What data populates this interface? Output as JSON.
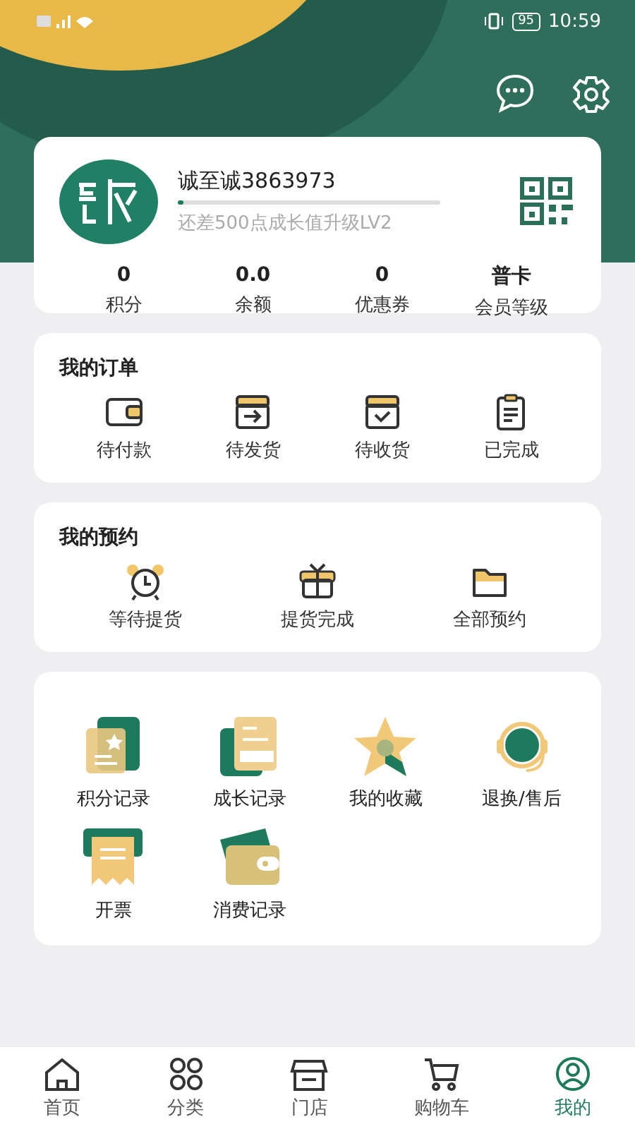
{
  "status_bar": {
    "time": "10:59",
    "battery": "95"
  },
  "profile": {
    "name": "诚至诚3863973",
    "level": 0.02,
    "hint": "还差500点成长值升级LV2",
    "stats": [
      {
        "value": "0",
        "label": "积分"
      },
      {
        "value": "0.0",
        "label": "余额"
      },
      {
        "value": "0",
        "label": "优惠券"
      },
      {
        "value": "普卡",
        "label": "会员等级"
      }
    ]
  },
  "orders": {
    "title": "我的订单",
    "items": [
      {
        "kind": "wallet",
        "label": "待付款"
      },
      {
        "kind": "ship",
        "label": "待发货"
      },
      {
        "kind": "receive",
        "label": "待收货"
      },
      {
        "kind": "done",
        "label": "已完成"
      }
    ]
  },
  "bookings": {
    "title": "我的预约",
    "items": [
      {
        "kind": "alarm",
        "label": "等待提货"
      },
      {
        "kind": "gift",
        "label": "提货完成"
      },
      {
        "kind": "folder",
        "label": "全部预约"
      }
    ]
  },
  "services": [
    {
      "kind": "points",
      "label": "积分记录"
    },
    {
      "kind": "growth",
      "label": "成长记录"
    },
    {
      "kind": "star",
      "label": "我的收藏"
    },
    {
      "kind": "support",
      "label": "退换/售后"
    },
    {
      "kind": "invoice",
      "label": "开票"
    },
    {
      "kind": "card",
      "label": "消费记录"
    }
  ],
  "tab_bar": [
    {
      "kind": "home",
      "label": "首页",
      "selected": false
    },
    {
      "kind": "grid",
      "label": "分类",
      "selected": false
    },
    {
      "kind": "store",
      "label": "门店",
      "selected": false
    },
    {
      "kind": "cart",
      "label": "购物车",
      "selected": false
    },
    {
      "kind": "user",
      "label": "我的",
      "selected": true
    }
  ]
}
